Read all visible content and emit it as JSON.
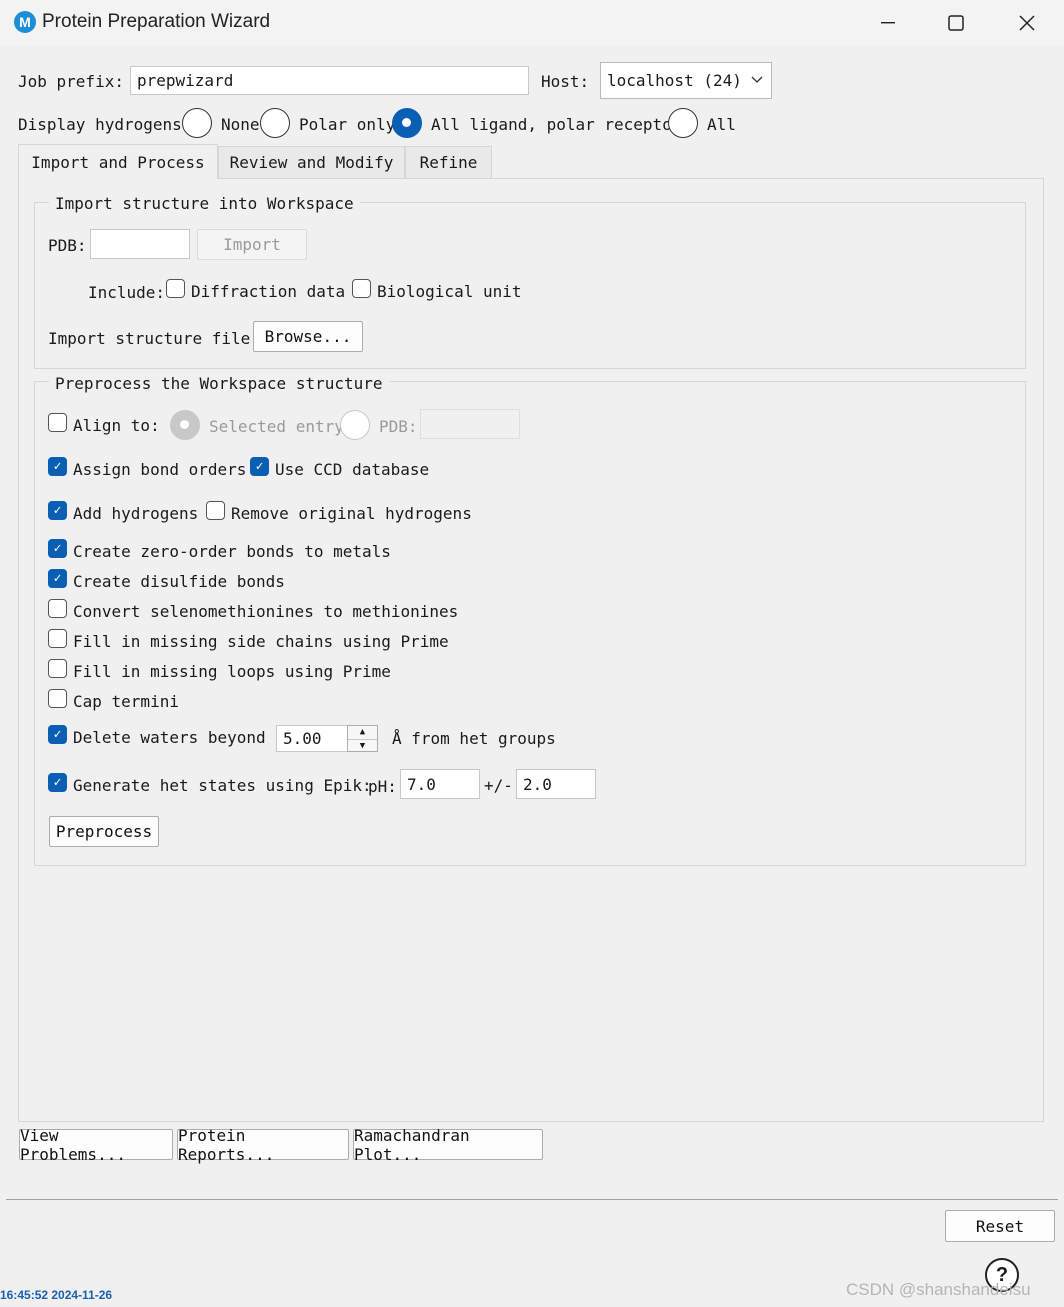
{
  "window": {
    "title": "Protein Preparation Wizard",
    "logo_letter": "M",
    "minimize_icon": "minimize-icon",
    "maximize_icon": "maximize-icon",
    "close_icon": "close-icon"
  },
  "header": {
    "job_prefix_label": "Job prefix:",
    "job_prefix_value": "prepwizard",
    "host_label": "Host:",
    "host_value": "localhost (24)",
    "display_hydrogens_label": "Display hydrogens:",
    "hydrogen_options": [
      "None",
      "Polar only",
      "All ligand, polar receptor",
      "All"
    ],
    "hydrogen_selected": "All ligand, polar receptor"
  },
  "tabs": [
    {
      "label": "Import and Process",
      "active": true
    },
    {
      "label": "Review and Modify",
      "active": false
    },
    {
      "label": "Refine",
      "active": false
    }
  ],
  "import_group": {
    "title": "Import structure into Workspace",
    "pdb_label": "PDB:",
    "pdb_value": "",
    "import_button": "Import",
    "include_label": "Include:",
    "diffraction_label": "Diffraction data",
    "diffraction_checked": false,
    "biological_label": "Biological unit",
    "biological_checked": false,
    "import_file_label": "Import structure file:",
    "browse_button": "Browse..."
  },
  "preprocess_group": {
    "title": "Preprocess the Workspace structure",
    "align_label": "Align to:",
    "align_checked": false,
    "selected_entry_label": "Selected entry",
    "align_pdb_label": "PDB:",
    "align_pdb_value": "",
    "assign_bond_orders": "Assign bond orders",
    "use_ccd": "Use CCD database",
    "add_hydrogens": "Add hydrogens",
    "remove_original_hydrogens": "Remove original hydrogens",
    "zero_order": "Create zero-order bonds to metals",
    "disulfide": "Create disulfide bonds",
    "selenomethionines": "Convert selenomethionines to methionines",
    "side_chains": "Fill in missing side chains using Prime",
    "loops": "Fill in missing loops using Prime",
    "cap_termini": "Cap termini",
    "delete_waters": "Delete waters beyond",
    "waters_value": "5.00",
    "waters_unit": "Å from het groups",
    "het_states": "Generate het states using Epik:",
    "ph_label": "pH:",
    "ph_value": "7.0",
    "pm_label": "+/-",
    "pm_value": "2.0",
    "preprocess_button": "Preprocess",
    "checked": {
      "assign_bond_orders": true,
      "use_ccd": true,
      "add_hydrogens": true,
      "remove_original_hydrogens": false,
      "zero_order": true,
      "disulfide": true,
      "selenomethionines": false,
      "side_chains": false,
      "loops": false,
      "cap_termini": false,
      "delete_waters": true,
      "het_states": true
    }
  },
  "bottom_buttons": {
    "view_problems": "View Problems...",
    "protein_reports": "Protein Reports...",
    "ramachandran": "Ramachandran Plot...",
    "reset": "Reset",
    "help": "?"
  },
  "overlay": {
    "timestamp": "16:45:52 2024-11-26",
    "watermark": "CSDN @shanshandeisu"
  }
}
